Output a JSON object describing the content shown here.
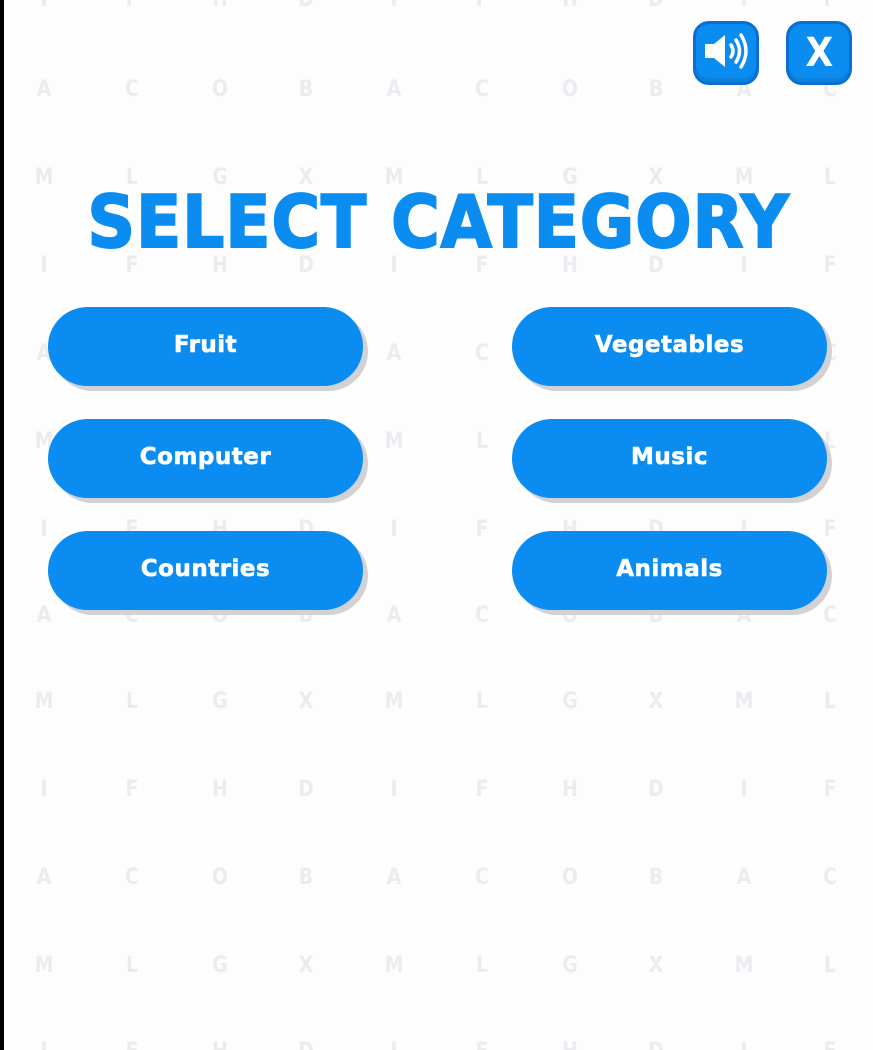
{
  "background_letters": [
    "I",
    "F",
    "H",
    "D",
    "I",
    "F",
    "H",
    "D",
    "I",
    "F",
    "A",
    "C",
    "O",
    "B",
    "A",
    "C",
    "O",
    "B",
    "A",
    "C",
    "M",
    "L",
    "G",
    "X",
    "M",
    "L",
    "G",
    "X",
    "M",
    "L"
  ],
  "controls": {
    "sound_icon": "speaker-volume-icon",
    "close_label": "X"
  },
  "title": "SELECT CATEGORY",
  "categories": [
    {
      "label": "Fruit"
    },
    {
      "label": "Vegetables"
    },
    {
      "label": "Computer"
    },
    {
      "label": "Music"
    },
    {
      "label": "Countries"
    },
    {
      "label": "Animals"
    }
  ],
  "colors": {
    "accent": "#0a8cf0",
    "background": "#fdfdfe",
    "watermark_letters": "#ececf0"
  }
}
